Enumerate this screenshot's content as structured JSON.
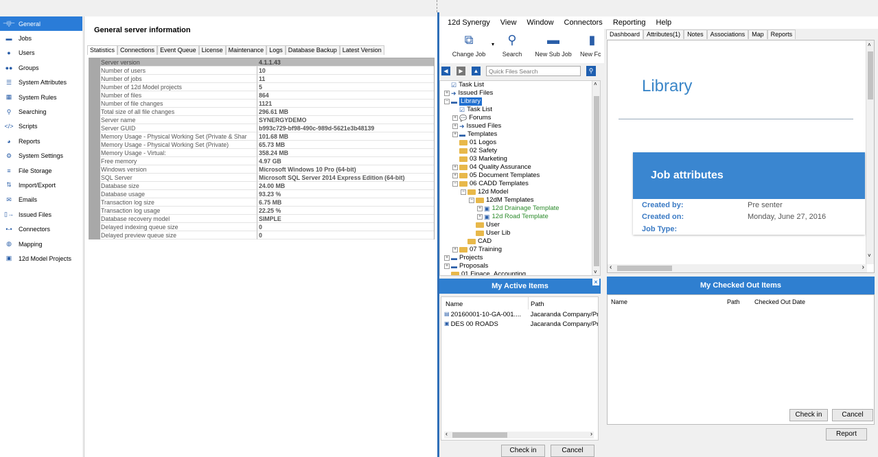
{
  "sidebar": {
    "items": [
      {
        "label": "General",
        "icon": "general-icon",
        "glyph": "⊣|⊢",
        "active": true
      },
      {
        "label": "Jobs",
        "icon": "jobs-icon",
        "glyph": "▬"
      },
      {
        "label": "Users",
        "icon": "user-icon",
        "glyph": "●"
      },
      {
        "label": "Groups",
        "icon": "groups-icon",
        "glyph": "●●"
      },
      {
        "label": "System Attributes",
        "icon": "list-icon",
        "glyph": "☰"
      },
      {
        "label": "System Rules",
        "icon": "rules-icon",
        "glyph": "▦"
      },
      {
        "label": "Searching",
        "icon": "search-icon",
        "glyph": "⚲"
      },
      {
        "label": "Scripts",
        "icon": "code-icon",
        "glyph": "</>"
      },
      {
        "label": "Reports",
        "icon": "pie-chart-icon",
        "glyph": "◕"
      },
      {
        "label": "System Settings",
        "icon": "gear-icon",
        "glyph": "⚙"
      },
      {
        "label": "File Storage",
        "icon": "database-icon",
        "glyph": "≡"
      },
      {
        "label": "Import/Export",
        "icon": "import-export-icon",
        "glyph": "⇅"
      },
      {
        "label": "Emails",
        "icon": "email-icon",
        "glyph": "✉"
      },
      {
        "label": "Issued Files",
        "icon": "issued-files-icon",
        "glyph": "▯→"
      },
      {
        "label": "Connectors",
        "icon": "connectors-icon",
        "glyph": "•-•"
      },
      {
        "label": "Mapping",
        "icon": "globe-icon",
        "glyph": "◍"
      },
      {
        "label": "12d Model Projects",
        "icon": "cube-icon",
        "glyph": "▣"
      }
    ]
  },
  "general": {
    "title": "General server information",
    "tabs": [
      "Statistics",
      "Connections",
      "Event Queue",
      "License",
      "Maintenance",
      "Logs",
      "Database Backup",
      "Latest Version"
    ],
    "stats": [
      [
        "Server version",
        "4.1.1.43"
      ],
      [
        "Number of users",
        "10"
      ],
      [
        "Number of jobs",
        "11"
      ],
      [
        "Number of 12d Model projects",
        "5"
      ],
      [
        "Number of files",
        "864"
      ],
      [
        "Number of file changes",
        "1121"
      ],
      [
        "Total size of all file changes",
        "296.61 MB"
      ],
      [
        "Server name",
        "SYNERGYDEMO"
      ],
      [
        "Server GUID",
        "b993c729-bf98-490c-989d-5621e3b48139"
      ],
      [
        "Memory Usage - Physical Working Set (Private & Shar",
        "101.68 MB"
      ],
      [
        "Memory Usage - Physical Working Set (Private)",
        "65.73 MB"
      ],
      [
        "Memory Usage - Virtual:",
        "358.24 MB"
      ],
      [
        "Free memory",
        "4.97 GB"
      ],
      [
        "Windows version",
        "Microsoft Windows 10 Pro (64-bit)"
      ],
      [
        "SQL Server",
        "Microsoft SQL Server 2014 Express Edition (64-bit)"
      ],
      [
        "Database size",
        "24.00 MB"
      ],
      [
        "Database usage",
        "93.23 %"
      ],
      [
        "Transaction log size",
        "6.75 MB"
      ],
      [
        "Transaction log usage",
        "22.25 %"
      ],
      [
        "Database recovery model",
        "SIMPLE"
      ],
      [
        "Delayed indexing queue size",
        "0"
      ],
      [
        "Delayed preview queue size",
        "0"
      ]
    ]
  },
  "app": {
    "menu": [
      "12d Synergy",
      "View",
      "Window",
      "Connectors",
      "Reporting",
      "Help"
    ],
    "toolbar": {
      "change_job": "Change Job",
      "search": "Search",
      "new_sub_job": "New Sub Job",
      "new_folder": "New Fc"
    },
    "quick_search_placeholder": "Quick Files Search",
    "tree": [
      {
        "label": "Task List",
        "depth": 1,
        "kind": "task"
      },
      {
        "label": "Issued Files",
        "depth": 1,
        "kind": "arrow",
        "exp": "+"
      },
      {
        "label": "Library",
        "depth": 1,
        "kind": "db",
        "exp": "-",
        "selected": true
      },
      {
        "label": "Task List",
        "depth": 2,
        "kind": "task"
      },
      {
        "label": "Forums",
        "depth": 2,
        "kind": "forum",
        "exp": "+"
      },
      {
        "label": "Issued Files",
        "depth": 2,
        "kind": "arrow",
        "exp": "+"
      },
      {
        "label": "Templates",
        "depth": 2,
        "kind": "db",
        "exp": "+"
      },
      {
        "label": "01 Logos",
        "depth": 2,
        "kind": "folder"
      },
      {
        "label": "02 Safety",
        "depth": 2,
        "kind": "folder"
      },
      {
        "label": "03 Marketing",
        "depth": 2,
        "kind": "folder"
      },
      {
        "label": "04 Quality Assurance",
        "depth": 2,
        "kind": "folder",
        "exp": "+"
      },
      {
        "label": "05 Document Templates",
        "depth": 2,
        "kind": "folder",
        "exp": "+"
      },
      {
        "label": "06 CADD Templates",
        "depth": 2,
        "kind": "folder",
        "exp": "-"
      },
      {
        "label": "12d Model",
        "depth": 3,
        "kind": "folder",
        "exp": "-"
      },
      {
        "label": "12dM Templates",
        "depth": 4,
        "kind": "folder",
        "exp": "-"
      },
      {
        "label": "12d Drainage Template",
        "depth": 5,
        "kind": "model",
        "exp": "+",
        "green": true
      },
      {
        "label": "12d Road Template",
        "depth": 5,
        "kind": "model",
        "exp": "+",
        "green": true
      },
      {
        "label": "User",
        "depth": 4,
        "kind": "folder"
      },
      {
        "label": "User Lib",
        "depth": 4,
        "kind": "folder"
      },
      {
        "label": "CAD",
        "depth": 3,
        "kind": "folder"
      },
      {
        "label": "07 Training",
        "depth": 2,
        "kind": "folder",
        "exp": "+"
      },
      {
        "label": "Projects",
        "depth": 1,
        "kind": "db",
        "exp": "+"
      },
      {
        "label": "Proposals",
        "depth": 1,
        "kind": "db",
        "exp": "+"
      },
      {
        "label": "01 Finace_Accounting",
        "depth": 1,
        "kind": "folder"
      }
    ],
    "active_items": {
      "title": "My Active Items",
      "col_name": "Name",
      "col_path": "Path",
      "rows": [
        {
          "name": "20160001-10-GA-001....",
          "path": "Jacaranda Company/Pr",
          "icon": "document-icon"
        },
        {
          "name": "DES 00 ROADS",
          "path": "Jacaranda Company/Pr",
          "icon": "model-icon"
        }
      ],
      "check_in": "Check in",
      "cancel": "Cancel"
    },
    "right_tabs": [
      "Dashboard",
      "Attributes(1)",
      "Notes",
      "Associations",
      "Map",
      "Reports"
    ],
    "dashboard": {
      "title": "Library",
      "job_attributes": "Job attributes",
      "created_by_label": "Created by:",
      "created_by": "Pre senter",
      "created_on_label": "Created on:",
      "created_on": "Monday, June 27, 2016",
      "job_type_label": "Job Type:"
    },
    "checked_out": {
      "title": "My Checked Out Items",
      "col_name": "Name",
      "col_path": "Path",
      "col_date": "Checked Out Date",
      "check_in": "Check in",
      "cancel": "Cancel",
      "report": "Report"
    }
  },
  "colors": {
    "accent": "#2a7cd8",
    "header": "#2f7fd0",
    "library_title": "#3a86c8",
    "template_green": "#2a8a2a"
  }
}
